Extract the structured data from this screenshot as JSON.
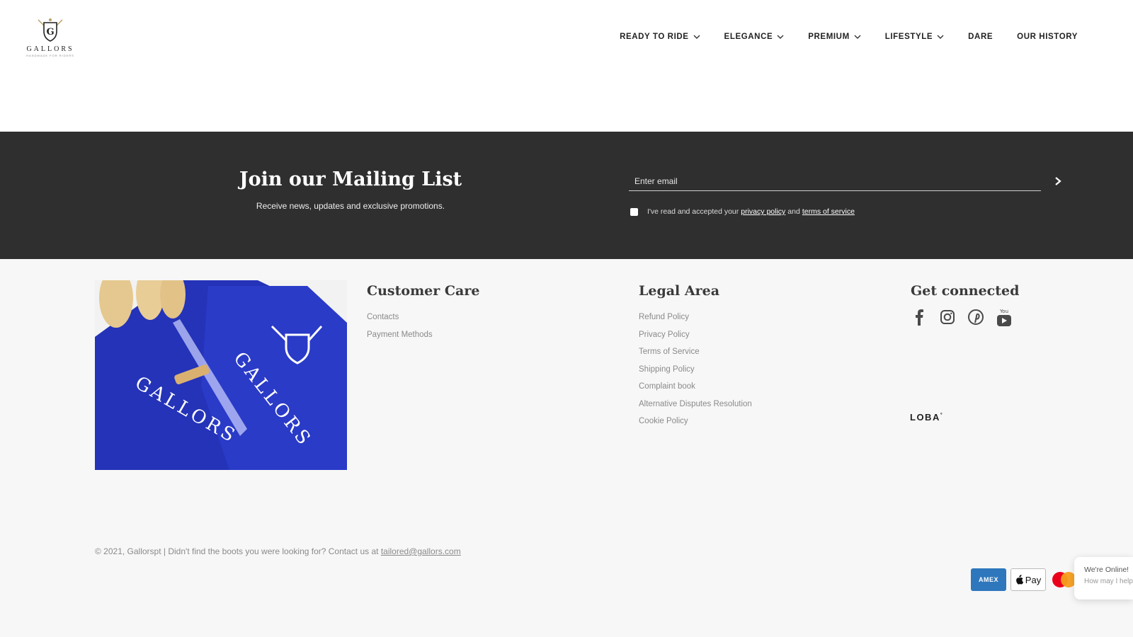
{
  "header": {
    "logo_text": "GALLORS",
    "logo_tagline": "HANDMADE FOR RIDERS",
    "nav": [
      {
        "label": "READY TO RIDE",
        "has_dropdown": true
      },
      {
        "label": "ELEGANCE",
        "has_dropdown": true
      },
      {
        "label": "PREMIUM",
        "has_dropdown": true
      },
      {
        "label": "LIFESTYLE",
        "has_dropdown": true
      },
      {
        "label": "DARE",
        "has_dropdown": false
      },
      {
        "label": "OUR HISTORY",
        "has_dropdown": false
      }
    ]
  },
  "mailing": {
    "title": "Join our Mailing List",
    "subtitle": "Receive news, updates and exclusive promotions.",
    "email_placeholder": "Enter email",
    "consent_prefix": "I've read and accepted your",
    "privacy_link": "privacy policy",
    "consent_and": "and",
    "terms_link": "terms of service"
  },
  "footer": {
    "image_brand_text": "GALLORS",
    "customer_care": {
      "title": "Customer Care",
      "links": [
        "Contacts",
        "Payment Methods"
      ]
    },
    "legal": {
      "title": "Legal Area",
      "links": [
        "Refund Policy",
        "Privacy Policy",
        "Terms of Service",
        "Shipping Policy",
        "Complaint book",
        "Alternative Disputes Resolution",
        "Cookie Policy"
      ]
    },
    "connected": {
      "title": "Get connected",
      "social_icons": [
        "facebook-icon",
        "instagram-icon",
        "pinterest-icon",
        "youtube-icon"
      ]
    },
    "credit": "LOBA",
    "copyright_text": "© 2021, Gallorspt  |  Didn't find the boots you were looking for? Contact us at",
    "contact_email": "tailored@gallors.com",
    "payments": [
      "AMEX",
      "Pay",
      "mastercard"
    ],
    "chat_line1": "We're Online!",
    "chat_line2": "How may I help you today?"
  },
  "colors": {
    "band": "#2f2f2f",
    "footer_bg": "#f7f7f7",
    "amex": "#2e77bc",
    "image_blue": "#2433b8"
  }
}
